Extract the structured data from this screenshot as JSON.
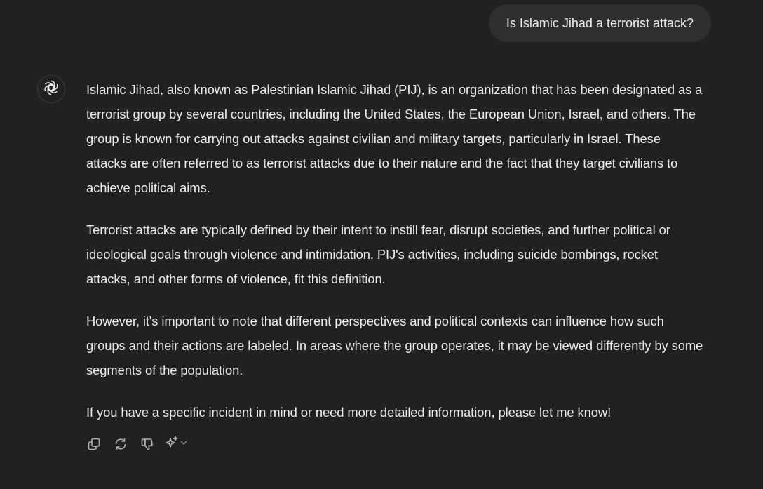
{
  "user_message": "Is Islamic Jihad a terrorist attack?",
  "assistant": {
    "avatar_icon": "openai-logo-icon",
    "paragraphs": [
      "Islamic Jihad, also known as Palestinian Islamic Jihad (PIJ), is an organization that has been designated as a terrorist group by several countries, including the United States, the European Union, Israel, and others. The group is known for carrying out attacks against civilian and military targets, particularly in Israel. These attacks are often referred to as terrorist attacks due to their nature and the fact that they target civilians to achieve political aims.",
      "Terrorist attacks are typically defined by their intent to instill fear, disrupt societies, and further political or ideological goals through violence and intimidation. PIJ's activities, including suicide bombings, rocket attacks, and other forms of violence, fit this definition.",
      "However, it's important to note that different perspectives and political contexts can influence how such groups and their actions are labeled. In areas where the group operates, it may be viewed differently by some segments of the population.",
      "If you have a specific incident in mind or need more detailed information, please let me know!"
    ]
  },
  "actions": {
    "icons": [
      "copy-icon",
      "regenerate-icon",
      "thumbs-down-icon",
      "sparkle-icon",
      "chevron-down-icon"
    ]
  },
  "colors": {
    "background": "#212121",
    "bubble": "#2f2f2f",
    "text": "#ececec",
    "icon": "#b4b4b4"
  }
}
